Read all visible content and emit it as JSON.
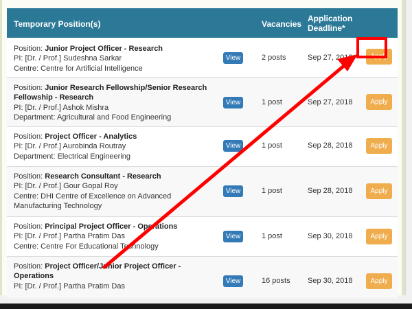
{
  "header": {
    "position_label": "Temporary Position(s)",
    "vacancies_label": "Vacancies",
    "deadline_label": "Application Deadline*"
  },
  "rows": [
    {
      "position_prefix": "Position: ",
      "position": "Junior Project Officer - Research",
      "pi": "PI: [Dr. / Prof.] Sudeshna Sarkar",
      "dept": "Centre: Centre for Artificial Intelligence",
      "view": "View",
      "vacancies": "2 posts",
      "deadline": "Sep 27, 2018",
      "apply": "Apply"
    },
    {
      "position_prefix": "Position: ",
      "position": "Junior Research Fellowship/Senior Research Fellowship - Research",
      "pi": "PI: [Dr. / Prof.] Ashok Mishra",
      "dept": "Department: Agricultural and Food Engineering",
      "view": "View",
      "vacancies": "1 post",
      "deadline": "Sep 27, 2018",
      "apply": "Apply"
    },
    {
      "position_prefix": "Position: ",
      "position": "Project Officer - Analytics",
      "pi": "PI: [Dr. / Prof.] Aurobinda Routray",
      "dept": "Department: Electrical Engineering",
      "view": "View",
      "vacancies": "1 post",
      "deadline": "Sep 28, 2018",
      "apply": "Apply"
    },
    {
      "position_prefix": "Position: ",
      "position": "Research Consultant - Research",
      "pi": "PI: [Dr. / Prof.] Gour Gopal Roy",
      "dept": "Centre: DHI Centre of Excellence on Advanced Manufacturing Technology",
      "view": "View",
      "vacancies": "1 post",
      "deadline": "Sep 28, 2018",
      "apply": "Apply"
    },
    {
      "position_prefix": "Position: ",
      "position": "Principal Project Officer - Operations",
      "pi": "PI: [Dr. / Prof.] Partha Pratim Das",
      "dept": "Centre: Centre For Educational Technology",
      "view": "View",
      "vacancies": "1 post",
      "deadline": "Sep 30, 2018",
      "apply": "Apply"
    },
    {
      "position_prefix": "Position: ",
      "position": "Project Officer/Junior Project Officer - Operations",
      "pi": "PI: [Dr. / Prof.] Partha Pratim Das",
      "dept": "",
      "view": "View",
      "vacancies": "16 posts",
      "deadline": "Sep 30, 2018",
      "apply": "Apply"
    }
  ],
  "annotation": {
    "color": "#ff0000"
  }
}
